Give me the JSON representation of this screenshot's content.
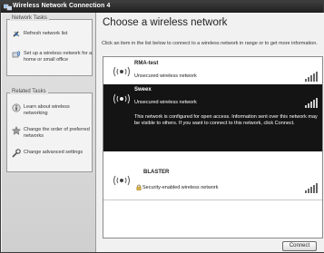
{
  "window": {
    "title": "Wireless Network Connection 4"
  },
  "network_tasks": {
    "header": "Network Tasks",
    "items": [
      {
        "label": "Refresh network list",
        "icon": "refresh-icon"
      },
      {
        "label": "Set up a wireless network for a home or small office",
        "icon": "setup-network-icon"
      }
    ]
  },
  "related_tasks": {
    "header": "Related Tasks",
    "items": [
      {
        "label": "Learn about wireless networking",
        "icon": "info-icon"
      },
      {
        "label": "Change the order of preferred networks",
        "icon": "star-icon"
      },
      {
        "label": "Change advanced settings",
        "icon": "settings-icon"
      }
    ]
  },
  "main": {
    "title": "Choose a wireless network",
    "instruction": "Click an item in the list below to connect to a wireless network in range or to get more information."
  },
  "networks": [
    {
      "name": "RMA-test",
      "status": "Unsecured wireless network",
      "selected": false
    },
    {
      "name": "Sweex",
      "status": "Unsecured wireless network",
      "selected": true,
      "description": "This network is configured for open access. Information sent over this network may be visible to others. If you want to connect to this network, click Connect."
    },
    {
      "name": "BLASTER",
      "status": "Security-enabled wireless network",
      "selected": false
    }
  ],
  "buttons": {
    "connect": "Connect"
  }
}
